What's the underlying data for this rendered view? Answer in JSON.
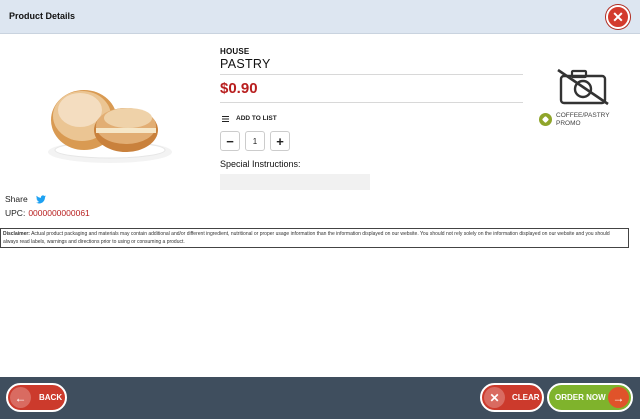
{
  "header": {
    "title": "Product Details",
    "close_icon": "close-icon"
  },
  "product": {
    "brand": "HOUSE",
    "name": "PASTRY",
    "price": "$0.90",
    "image_icon": "pastry-photo",
    "add_to_list_label": "ADD TO LIST",
    "quantity": "1",
    "decrement_label": "−",
    "increment_label": "+",
    "special_instructions_label": "Special Instructions:",
    "special_instructions_value": ""
  },
  "promo": {
    "text": "COFFEE/PASTRY PROMO",
    "icon": "tag-icon"
  },
  "share": {
    "label": "Share",
    "icon": "twitter-icon"
  },
  "upc": {
    "label": "UPC:",
    "value": "0000000000061"
  },
  "disclaimer": {
    "label": "Disclaimer:",
    "text": " Actual product packaging and materials may contain additional and/or different ingredient, nutritional or proper usage information than the information displayed on our website. You should not rely solely on the information displayed on our website and you should always read labels, warnings and directions prior to using or consuming a product."
  },
  "footer": {
    "back_label": "BACK",
    "clear_label": "CLEAR",
    "order_label": "ORDER NOW"
  },
  "colors": {
    "price": "#b81e1e",
    "back": "#cc3a2c",
    "order": "#7fb32c",
    "footer": "#3f4e5e",
    "header": "#dde6f1"
  }
}
